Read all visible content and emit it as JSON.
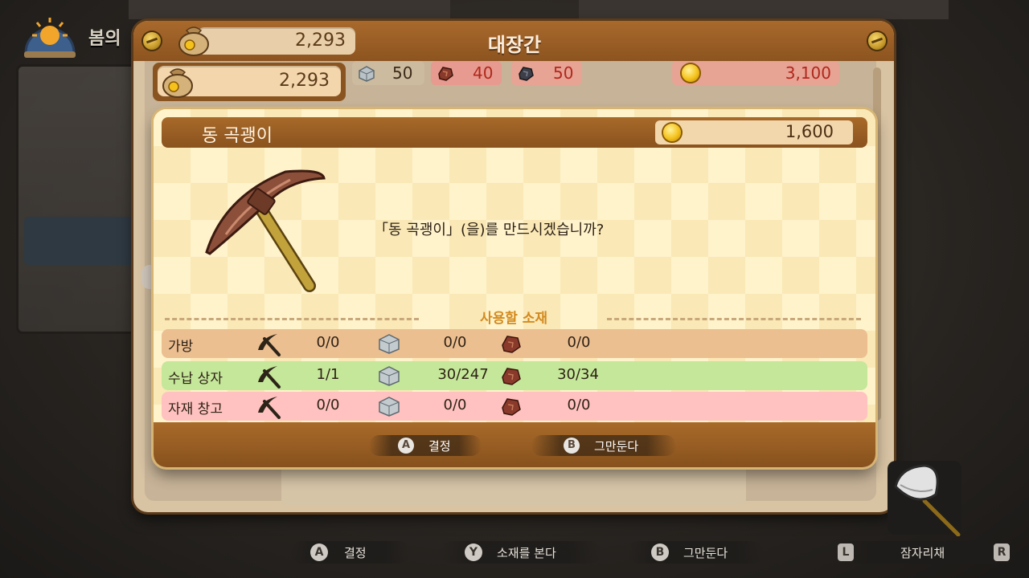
{
  "scene": {
    "season_label": "봄의"
  },
  "shop": {
    "title": "대장간",
    "money_header": "2,293",
    "money_current": "2,293",
    "materials_bar": [
      {
        "icon": "stone-block-icon",
        "value": "50"
      },
      {
        "icon": "copper-ore-icon",
        "value": "40"
      },
      {
        "icon": "iron-ore-icon",
        "value": "50"
      },
      {
        "icon": "gold-coin-icon",
        "value": "3,100"
      }
    ]
  },
  "dialog": {
    "item_name": "동 곡괭이",
    "price": "1,600",
    "question": "「동 곡괭이」(을)를 만드시겠습니까?",
    "materials_title": "사용할 소재",
    "rows": [
      {
        "label": "가방",
        "tool": "0/0",
        "stone": "0/0",
        "ore": "0/0",
        "color": "#ecbf91"
      },
      {
        "label": "수납 상자",
        "tool": "1/1",
        "stone": "30/247",
        "ore": "30/34",
        "color": "#c5e79a"
      },
      {
        "label": "자재 창고",
        "tool": "0/0",
        "stone": "0/0",
        "ore": "0/0",
        "color": "#ffc2c0"
      }
    ],
    "buttons": {
      "confirm_key": "A",
      "confirm_label": "결정",
      "cancel_key": "B",
      "cancel_label": "그만둔다"
    }
  },
  "hints": {
    "a_key": "A",
    "a_label": "결정",
    "y_key": "Y",
    "y_label": "소재를 본다",
    "b_key": "B",
    "b_label": "그만둔다",
    "l_key": "L",
    "r_key": "R",
    "rotate_label": "잠자리채"
  }
}
